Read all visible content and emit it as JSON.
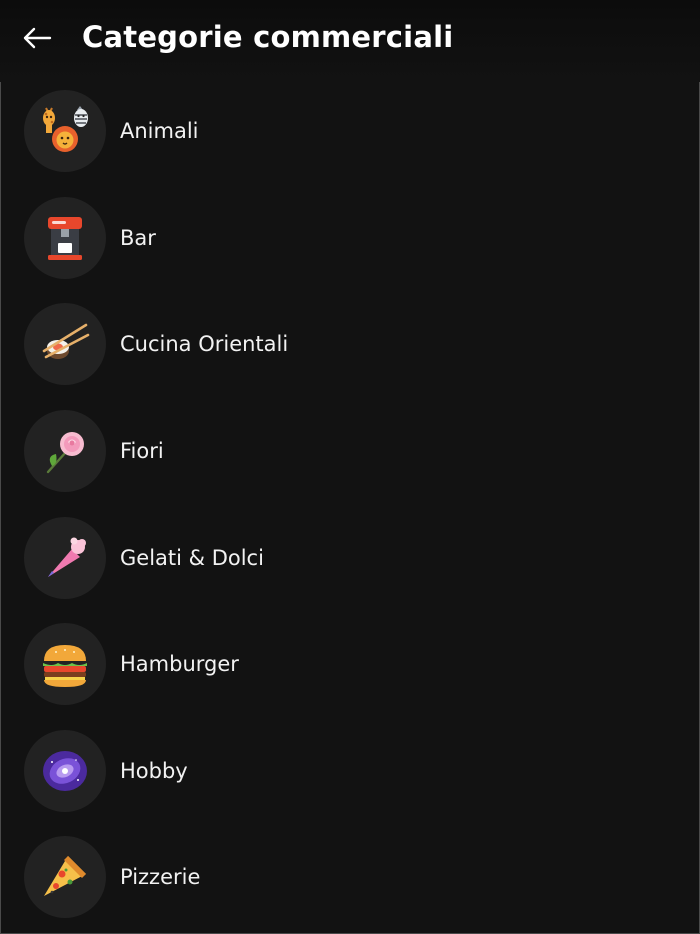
{
  "header": {
    "title": "Categorie commerciali",
    "back_icon": "arrow-left-icon"
  },
  "categories": [
    {
      "label": "Animali",
      "icon": "animals-icon"
    },
    {
      "label": "Bar",
      "icon": "coffee-machine-icon"
    },
    {
      "label": "Cucina Orientali",
      "icon": "sushi-chopsticks-icon"
    },
    {
      "label": "Fiori",
      "icon": "rose-icon"
    },
    {
      "label": "Gelati & Dolci",
      "icon": "piping-bag-icon"
    },
    {
      "label": "Hamburger",
      "icon": "hamburger-icon"
    },
    {
      "label": "Hobby",
      "icon": "galaxy-icon"
    },
    {
      "label": "Pizzerie",
      "icon": "pizza-slice-icon"
    }
  ],
  "colors": {
    "background": "#121212",
    "avatar_bg": "#222222",
    "text": "#ffffff"
  }
}
